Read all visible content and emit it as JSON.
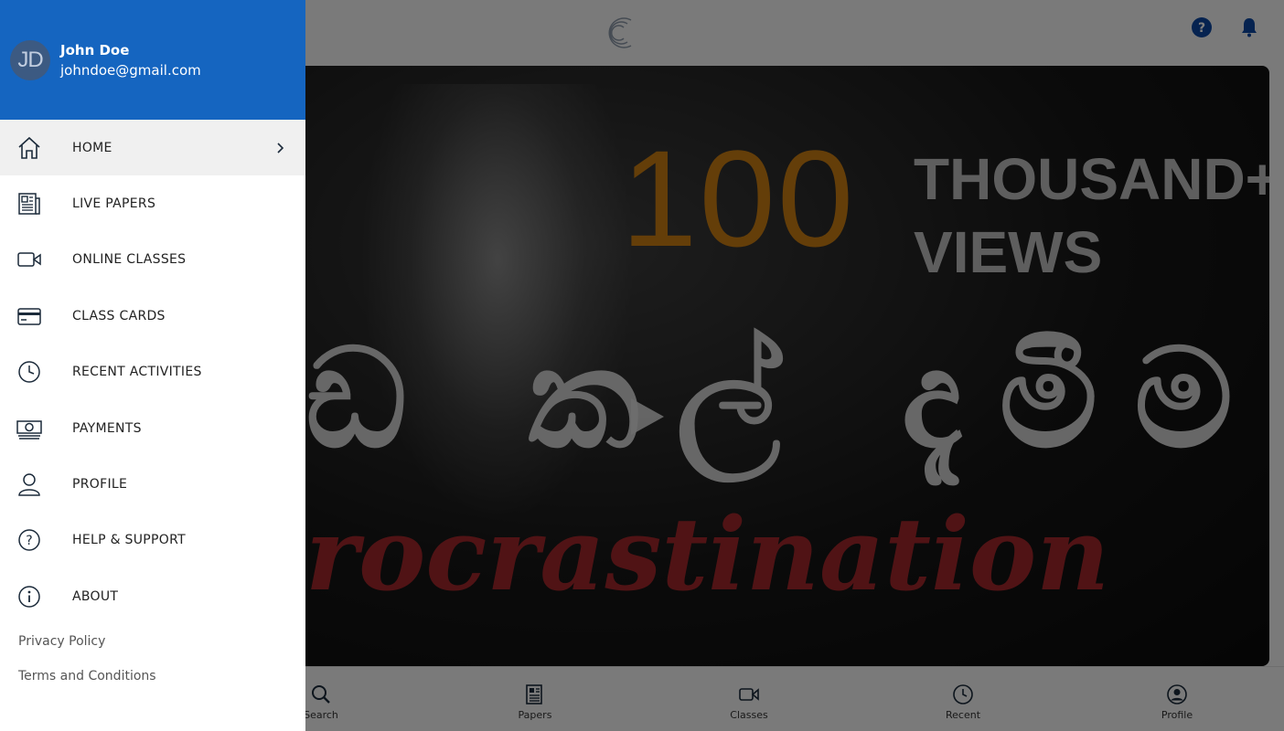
{
  "user": {
    "initials": "JD",
    "name": "John Doe",
    "email": "johndoe@gmail.com"
  },
  "menu": {
    "items": [
      {
        "label": "HOME",
        "icon": "home-icon",
        "active": true
      },
      {
        "label": "LIVE PAPERS",
        "icon": "newspaper-icon"
      },
      {
        "label": "ONLINE CLASSES",
        "icon": "video-camera-icon"
      },
      {
        "label": "CLASS CARDS",
        "icon": "credit-card-icon"
      },
      {
        "label": "RECENT ACTIVITIES",
        "icon": "clock-icon"
      },
      {
        "label": "PAYMENTS",
        "icon": "cash-icon"
      },
      {
        "label": "PROFILE",
        "icon": "person-icon"
      },
      {
        "label": "HELP & SUPPORT",
        "icon": "help-circle-icon"
      },
      {
        "label": "ABOUT",
        "icon": "info-icon"
      }
    ]
  },
  "footer": {
    "privacy": "Privacy Policy",
    "terms": "Terms and Conditions"
  },
  "video": {
    "big_number": "100",
    "line1": "THOUSAND+",
    "line2": "VIEWS",
    "sinhala": "ඩ කල් දැමීම",
    "subtitle": "rocrastination"
  },
  "bottom_nav": [
    {
      "label": "Search",
      "icon": "search-icon"
    },
    {
      "label": "Papers",
      "icon": "newspaper-icon"
    },
    {
      "label": "Classes",
      "icon": "video-camera-icon"
    },
    {
      "label": "Recent",
      "icon": "clock-icon"
    },
    {
      "label": "Profile",
      "icon": "account-circle-icon"
    }
  ],
  "colors": {
    "brand": "#1565c0",
    "accent_icon": "#0d47a1",
    "drawer_bg": "#ffffff",
    "active_row": "#f0f0f0"
  }
}
